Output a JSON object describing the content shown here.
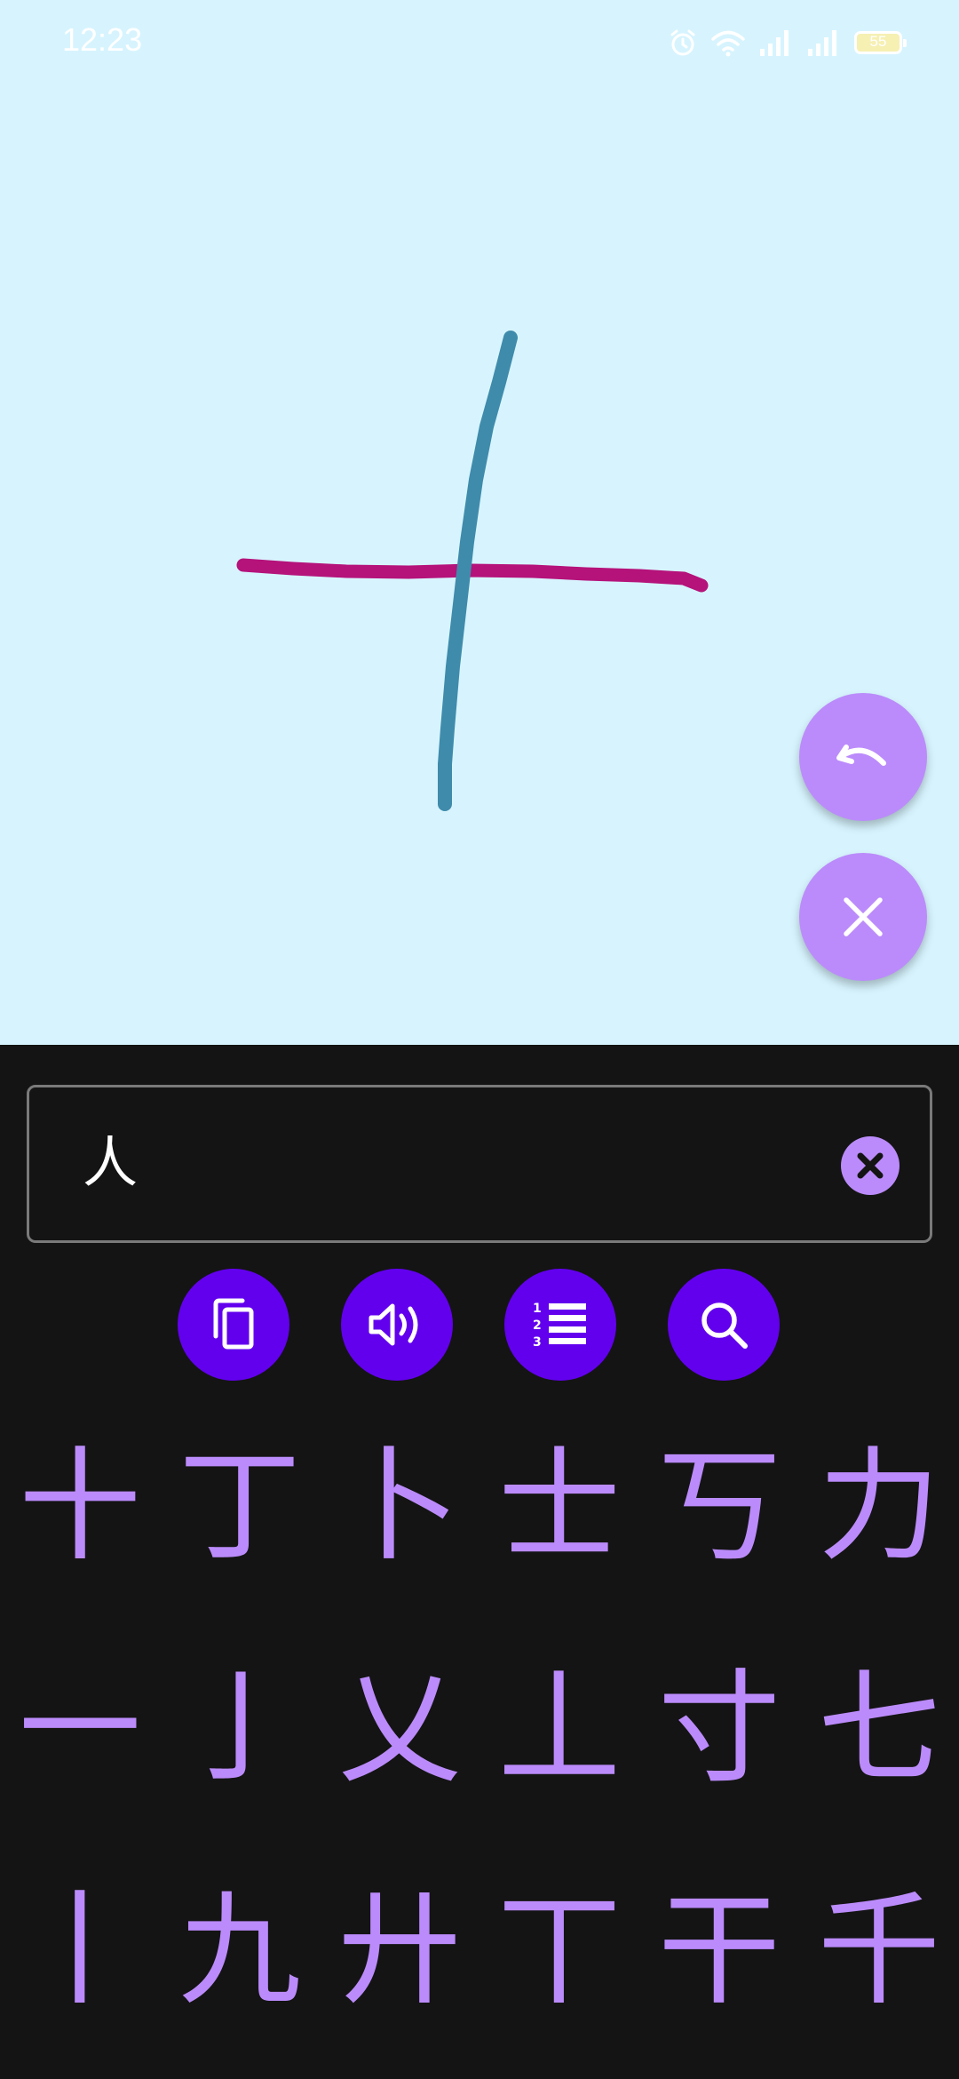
{
  "status_bar": {
    "time": "12:23",
    "battery_level": "55",
    "icons": [
      "alarm-icon",
      "wifi-icon",
      "signal-icon",
      "signal-icon",
      "battery-icon"
    ]
  },
  "drawing": {
    "stroke_colors": [
      "#b5127a",
      "#3f8bab"
    ],
    "background": "#d7f4fe"
  },
  "fabs": {
    "undo_icon": "undo-icon",
    "clear_icon": "close-icon",
    "color": "#bb8bfb"
  },
  "result": {
    "text": "人",
    "clear_icon": "close-circle-icon"
  },
  "actions": [
    {
      "name": "copy-button",
      "icon": "copy-icon"
    },
    {
      "name": "speak-button",
      "icon": "speaker-icon"
    },
    {
      "name": "list-button",
      "icon": "numbered-list-icon"
    },
    {
      "name": "search-button",
      "icon": "search-icon"
    }
  ],
  "candidates": [
    [
      "十",
      "丁",
      "卜",
      "士",
      "丂",
      "力"
    ],
    [
      "一",
      "亅",
      "乂",
      "丄",
      "寸",
      "七"
    ],
    [
      "丨",
      "九",
      "廾",
      "丅",
      "干",
      "千"
    ]
  ],
  "colors": {
    "accent": "#bb8bfb",
    "primary": "#6200ee",
    "panel_bg": "#141414"
  }
}
